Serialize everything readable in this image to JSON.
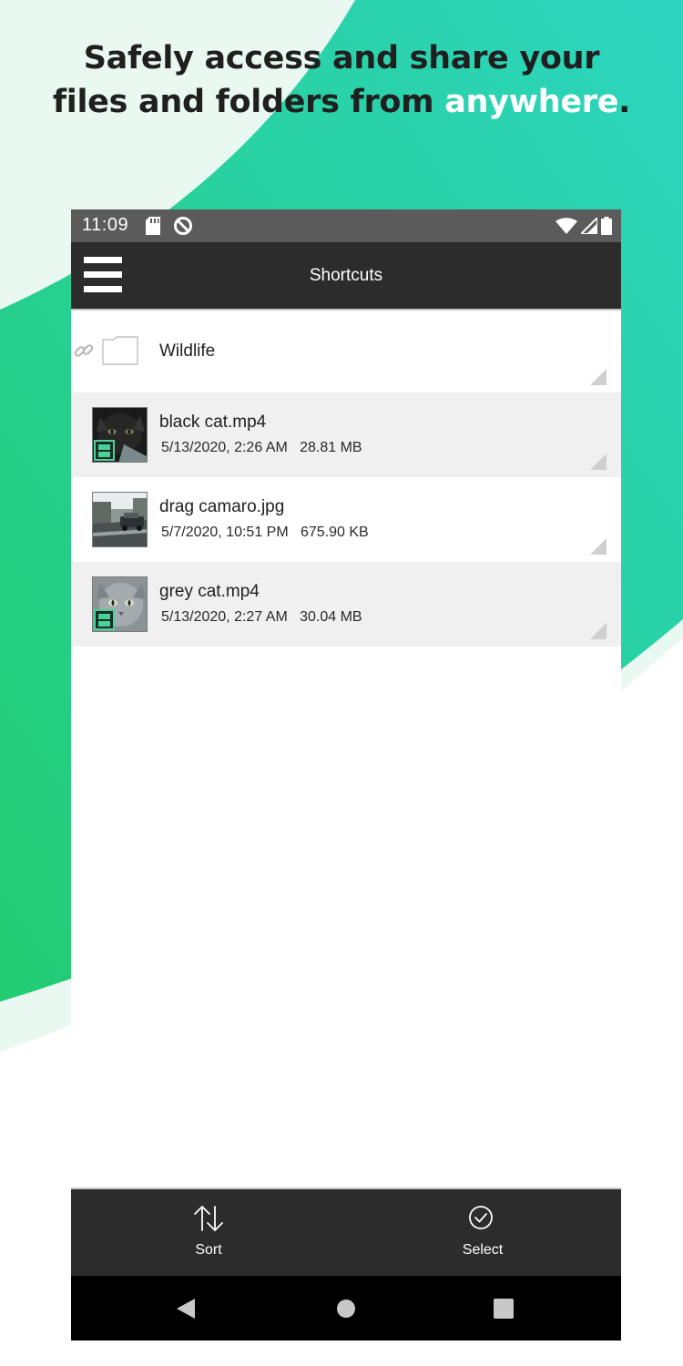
{
  "marketing": {
    "headline_line1": "Safely access and share your",
    "headline_line2_prefix": "files and folders from ",
    "headline_accent": "anywhere",
    "headline_suffix": "."
  },
  "colors": {
    "brand_green": "#26cf7e",
    "brand_teal": "#2bd6b9",
    "app_bar": "#2c2c2c",
    "status_bar": "#5b5b5b",
    "row_alt": "#f0f0f0"
  },
  "status_bar": {
    "time": "11:09",
    "icons": [
      "sd-card-icon",
      "do-not-disturb-icon",
      "wifi-icon",
      "cell-signal-icon",
      "battery-icon"
    ]
  },
  "app_bar": {
    "menu_icon": "hamburger-menu-icon",
    "title": "Shortcuts"
  },
  "files": [
    {
      "name": "Wildlife",
      "type": "folder",
      "meta": "",
      "icon": "folder-icon",
      "shared": true
    },
    {
      "name": "black cat.mp4",
      "type": "video",
      "meta": "5/13/2020, 2:26 AM   28.81 MB",
      "icon": "video-thumbnail"
    },
    {
      "name": "drag camaro.jpg",
      "type": "image",
      "meta": "5/7/2020, 10:51 PM   675.90 KB",
      "icon": "image-thumbnail"
    },
    {
      "name": "grey cat.mp4",
      "type": "video",
      "meta": "5/13/2020, 2:27 AM   30.04 MB",
      "icon": "video-thumbnail"
    }
  ],
  "bottom_bar": {
    "sort_label": "Sort",
    "sort_icon": "sort-arrows-icon",
    "select_label": "Select",
    "select_icon": "check-circle-icon"
  },
  "nav_bar": {
    "buttons": [
      "back-icon",
      "home-icon",
      "recents-icon"
    ]
  }
}
